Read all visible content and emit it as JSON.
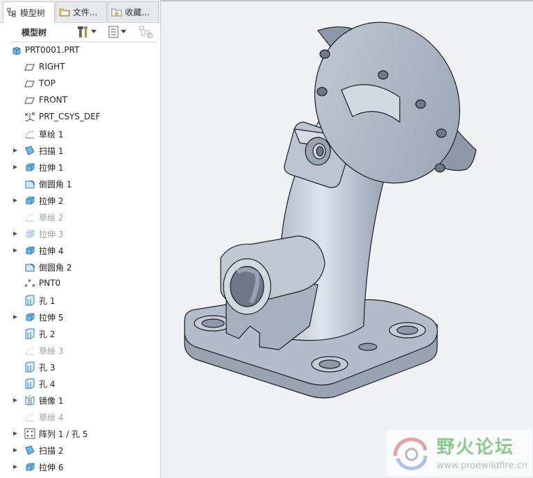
{
  "tabs": [
    {
      "label": "模型树",
      "icon": "model-tree-icon",
      "active": true
    },
    {
      "label": "文件...",
      "icon": "folder-icon",
      "active": false
    },
    {
      "label": "收藏...",
      "icon": "favorites-icon",
      "active": false
    }
  ],
  "toolbar": {
    "title": "模型树"
  },
  "tree": {
    "root": "PRT0001.PRT",
    "items": [
      {
        "label": "RIGHT",
        "icon": "datum-plane-icon",
        "expandable": false,
        "dim": false
      },
      {
        "label": "TOP",
        "icon": "datum-plane-icon",
        "expandable": false,
        "dim": false
      },
      {
        "label": "FRONT",
        "icon": "datum-plane-icon",
        "expandable": false,
        "dim": false
      },
      {
        "label": "PRT_CSYS_DEF",
        "icon": "csys-icon",
        "expandable": false,
        "dim": false
      },
      {
        "label": "草绘 1",
        "icon": "sketch-icon",
        "expandable": false,
        "dim": false
      },
      {
        "label": "扫描 1",
        "icon": "sweep-icon",
        "expandable": true,
        "dim": false
      },
      {
        "label": "拉伸 1",
        "icon": "extrude-icon",
        "expandable": true,
        "dim": false
      },
      {
        "label": "倒圆角 1",
        "icon": "round-icon",
        "expandable": false,
        "dim": false
      },
      {
        "label": "拉伸 2",
        "icon": "extrude-icon",
        "expandable": true,
        "dim": false
      },
      {
        "label": "草绘 2",
        "icon": "sketch-icon",
        "expandable": false,
        "dim": true
      },
      {
        "label": "拉伸 3",
        "icon": "extrude-icon",
        "expandable": true,
        "dim": true
      },
      {
        "label": "拉伸 4",
        "icon": "extrude-icon",
        "expandable": true,
        "dim": false
      },
      {
        "label": "倒圆角 2",
        "icon": "round-icon",
        "expandable": false,
        "dim": false
      },
      {
        "label": "PNT0",
        "icon": "datum-point-icon",
        "expandable": false,
        "dim": false
      },
      {
        "label": "孔 1",
        "icon": "hole-icon",
        "expandable": false,
        "dim": false
      },
      {
        "label": "拉伸 5",
        "icon": "extrude-icon",
        "expandable": true,
        "dim": false
      },
      {
        "label": "孔 2",
        "icon": "hole-icon",
        "expandable": false,
        "dim": false
      },
      {
        "label": "草绘 3",
        "icon": "sketch-icon",
        "expandable": false,
        "dim": true
      },
      {
        "label": "孔 3",
        "icon": "hole-icon",
        "expandable": false,
        "dim": false
      },
      {
        "label": "孔 4",
        "icon": "hole-icon",
        "expandable": false,
        "dim": false
      },
      {
        "label": "镜像 1",
        "icon": "mirror-icon",
        "expandable": true,
        "dim": false
      },
      {
        "label": "草绘 4",
        "icon": "sketch-icon",
        "expandable": false,
        "dim": true
      },
      {
        "label": "阵列 1 / 孔 5",
        "icon": "pattern-icon",
        "expandable": true,
        "dim": false
      },
      {
        "label": "扫描 2",
        "icon": "sweep-icon",
        "expandable": true,
        "dim": false
      },
      {
        "label": "拉伸 6",
        "icon": "extrude-icon",
        "expandable": true,
        "dim": false
      }
    ]
  },
  "watermark": {
    "title": "野火论坛",
    "url": "www.proewildfire.cn"
  },
  "colors": {
    "part": "#aeb7c6",
    "part_dark": "#8e98a8",
    "part_light": "#d0d6df",
    "edge": "#1b1d22",
    "viewport": "#eff1f3",
    "watermark_green": "#8cc98a"
  }
}
